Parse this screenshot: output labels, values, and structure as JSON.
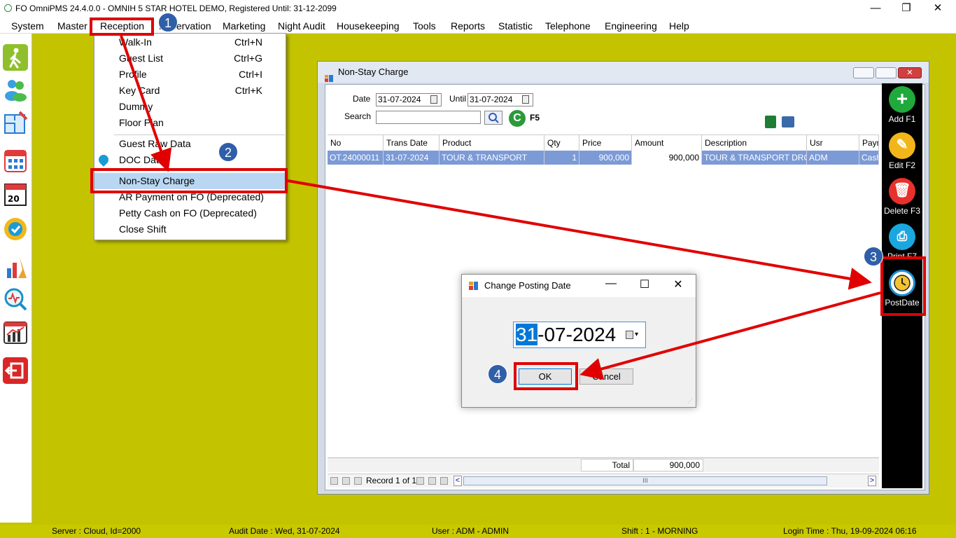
{
  "window": {
    "title": "FO OmniPMS 24.4.0.0 - OMNIH 5 STAR HOTEL DEMO, Registered Until: 31-12-2099",
    "minimize": "—",
    "maximize": "❐",
    "close": "✕"
  },
  "menubar": [
    "System",
    "Master",
    "Reception",
    "Reservation",
    "Marketing",
    "Night Audit",
    "Housekeeping",
    "Tools",
    "Reports",
    "Statistic",
    "Telephone",
    "Engineering",
    "Help"
  ],
  "reception_menu": [
    {
      "label": "Walk-In",
      "shortcut": "Ctrl+N"
    },
    {
      "label": "Guest List",
      "shortcut": "Ctrl+G"
    },
    {
      "label": "Profile",
      "shortcut": "Ctrl+I"
    },
    {
      "label": "Key Card",
      "shortcut": "Ctrl+K"
    },
    {
      "label": "Dummy",
      "shortcut": ""
    },
    {
      "label": "Floor Plan",
      "shortcut": ""
    },
    {
      "label": "Guest Raw Data",
      "shortcut": ""
    },
    {
      "label": "DOC Data",
      "shortcut": ""
    },
    {
      "label": "Non-Stay Charge",
      "shortcut": ""
    },
    {
      "label": "AR Payment on FO (Deprecated)",
      "shortcut": ""
    },
    {
      "label": "Petty Cash on FO (Deprecated)",
      "shortcut": ""
    },
    {
      "label": "Close Shift",
      "shortcut": ""
    }
  ],
  "nonstay": {
    "title": "Non-Stay Charge",
    "date_label": "Date",
    "date_value": "31-07-2024",
    "until_label": "Until",
    "until_value": "31-07-2024",
    "search_label": "Search",
    "search_value": "",
    "refresh_key": "F5",
    "columns": [
      "No",
      "Trans Date",
      "Product",
      "Qty",
      "Price",
      "Amount",
      "Description",
      "Usr",
      "Paym"
    ],
    "rows": [
      [
        "OT.24000011",
        "31-07-2024",
        "TOUR & TRANSPORT",
        "1",
        "900,000",
        "900,000",
        "TOUR & TRANSPORT DROP…",
        "ADM",
        "Cash"
      ]
    ],
    "total_label": "Total",
    "total_value": "900,000",
    "record_text": "Record 1 of 1",
    "scroll_mid": "III"
  },
  "rightbar": [
    {
      "label": "Add F1",
      "icon": "plus-icon",
      "color": "#1faa3b"
    },
    {
      "label": "Edit F2",
      "icon": "edit-icon",
      "color": "#f3b61a"
    },
    {
      "label": "Delete F3",
      "icon": "trash-icon",
      "color": "#e8302c"
    },
    {
      "label": "Print F7",
      "icon": "print-icon",
      "color": "#1aa7e0"
    },
    {
      "label": "PostDate",
      "icon": "clock-icon",
      "color": "#1a90d0"
    }
  ],
  "dialog": {
    "title": "Change Posting Date",
    "date_day": "31",
    "date_rest": "-07-2024",
    "ok": "OK",
    "cancel": "Cancel"
  },
  "callouts": [
    "1",
    "2",
    "3",
    "4"
  ],
  "status": {
    "server": "Server : Cloud, Id=2000",
    "audit": "Audit Date : Wed, 31-07-2024",
    "user": "User : ADM - ADMIN",
    "shift": "Shift : 1 - MORNING",
    "login": "Login Time : Thu, 19-09-2024 06:16"
  }
}
